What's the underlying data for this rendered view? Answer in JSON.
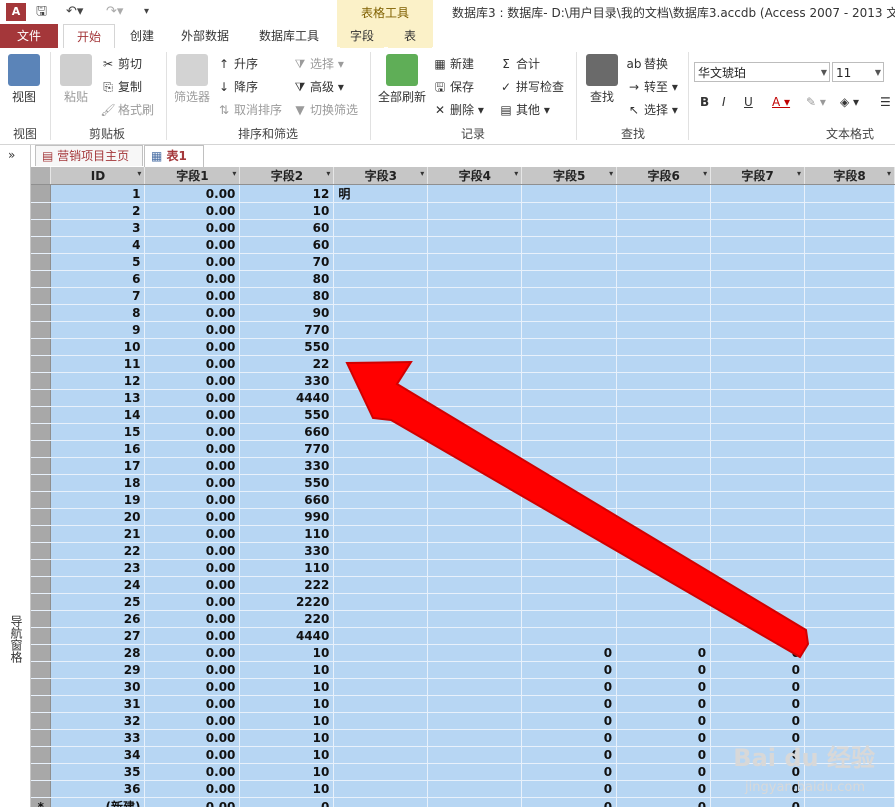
{
  "titlebar": {
    "context_group": "表格工具",
    "window_title": "数据库3 : 数据库- D:\\用户目录\\我的文档\\数据库3.accdb (Access 2007 - 2013 文"
  },
  "tabs": {
    "file": "文件",
    "home": "开始",
    "create": "创建",
    "external": "外部数据",
    "dbtools": "数据库工具",
    "fields": "字段",
    "table": "表"
  },
  "ribbon": {
    "view": {
      "button": "视图",
      "group": "视图"
    },
    "clipboard": {
      "paste": "粘贴",
      "cut": "剪切",
      "copy": "复制",
      "format_painter": "格式刷",
      "group": "剪贴板"
    },
    "sort": {
      "filter": "筛选器",
      "ascending": "升序",
      "descending": "降序",
      "remove_sort": "取消排序",
      "selection": "选择",
      "advanced": "高级",
      "toggle_filter": "切换筛选",
      "group": "排序和筛选"
    },
    "records": {
      "refresh_all": "全部刷新",
      "new": "新建",
      "save": "保存",
      "delete": "删除",
      "totals": "合计",
      "spelling": "拼写检查",
      "more": "其他",
      "group": "记录"
    },
    "find": {
      "find": "查找",
      "replace": "替换",
      "goto": "转至",
      "select": "选择",
      "group": "查找"
    },
    "text": {
      "font": "华文琥珀",
      "size": "11",
      "group": "文本格式"
    }
  },
  "nav": {
    "label": "导航窗格"
  },
  "doc_tabs": [
    "营销项目主页",
    "表1"
  ],
  "table": {
    "columns": [
      "ID",
      "字段1",
      "字段2",
      "字段3",
      "字段4",
      "字段5",
      "字段6",
      "字段7",
      "字段8"
    ],
    "rows": [
      [
        "1",
        "0.00",
        "12",
        "明",
        "",
        "",
        "",
        ""
      ],
      [
        "2",
        "0.00",
        "10",
        "",
        "",
        "",
        "",
        ""
      ],
      [
        "3",
        "0.00",
        "60",
        "",
        "",
        "",
        "",
        ""
      ],
      [
        "4",
        "0.00",
        "60",
        "",
        "",
        "",
        "",
        ""
      ],
      [
        "5",
        "0.00",
        "70",
        "",
        "",
        "",
        "",
        ""
      ],
      [
        "6",
        "0.00",
        "80",
        "",
        "",
        "",
        "",
        ""
      ],
      [
        "7",
        "0.00",
        "80",
        "",
        "",
        "",
        "",
        ""
      ],
      [
        "8",
        "0.00",
        "90",
        "",
        "",
        "",
        "",
        ""
      ],
      [
        "9",
        "0.00",
        "770",
        "",
        "",
        "",
        "",
        ""
      ],
      [
        "10",
        "0.00",
        "550",
        "",
        "",
        "",
        "",
        ""
      ],
      [
        "11",
        "0.00",
        "22",
        "",
        "",
        "",
        "",
        ""
      ],
      [
        "12",
        "0.00",
        "330",
        "",
        "",
        "",
        "",
        ""
      ],
      [
        "13",
        "0.00",
        "4440",
        "",
        "",
        "",
        "",
        ""
      ],
      [
        "14",
        "0.00",
        "550",
        "",
        "",
        "",
        "",
        ""
      ],
      [
        "15",
        "0.00",
        "660",
        "",
        "",
        "",
        "",
        ""
      ],
      [
        "16",
        "0.00",
        "770",
        "",
        "",
        "",
        "",
        ""
      ],
      [
        "17",
        "0.00",
        "330",
        "",
        "",
        "",
        "",
        ""
      ],
      [
        "18",
        "0.00",
        "550",
        "",
        "",
        "",
        "",
        ""
      ],
      [
        "19",
        "0.00",
        "660",
        "",
        "",
        "",
        "",
        ""
      ],
      [
        "20",
        "0.00",
        "990",
        "",
        "",
        "",
        "",
        ""
      ],
      [
        "21",
        "0.00",
        "110",
        "",
        "",
        "",
        "",
        ""
      ],
      [
        "22",
        "0.00",
        "330",
        "",
        "",
        "",
        "",
        ""
      ],
      [
        "23",
        "0.00",
        "110",
        "",
        "",
        "",
        "",
        ""
      ],
      [
        "24",
        "0.00",
        "222",
        "",
        "",
        "",
        "",
        ""
      ],
      [
        "25",
        "0.00",
        "2220",
        "",
        "",
        "",
        "",
        ""
      ],
      [
        "26",
        "0.00",
        "220",
        "",
        "",
        "",
        "",
        ""
      ],
      [
        "27",
        "0.00",
        "4440",
        "",
        "",
        "",
        "",
        ""
      ],
      [
        "28",
        "0.00",
        "10",
        "",
        "",
        "0",
        "0",
        "0"
      ],
      [
        "29",
        "0.00",
        "10",
        "",
        "",
        "0",
        "0",
        "0"
      ],
      [
        "30",
        "0.00",
        "10",
        "",
        "",
        "0",
        "0",
        "0"
      ],
      [
        "31",
        "0.00",
        "10",
        "",
        "",
        "0",
        "0",
        "0"
      ],
      [
        "32",
        "0.00",
        "10",
        "",
        "",
        "0",
        "0",
        "0"
      ],
      [
        "33",
        "0.00",
        "10",
        "",
        "",
        "0",
        "0",
        "0"
      ],
      [
        "34",
        "0.00",
        "10",
        "",
        "",
        "0",
        "0",
        "0"
      ],
      [
        "35",
        "0.00",
        "10",
        "",
        "",
        "0",
        "0",
        "0"
      ],
      [
        "36",
        "0.00",
        "10",
        "",
        "",
        "0",
        "0",
        "0"
      ],
      [
        "(新建)",
        "0.00",
        "0",
        "",
        "",
        "0",
        "0",
        "0"
      ]
    ],
    "new_row_marker": "*"
  },
  "watermark": {
    "brand": "Bai du 经验",
    "url": "jingyan.baidu.com"
  },
  "colors": {
    "accent": "#a4373a",
    "grid_bg": "#b7d6f3",
    "arrow": "#ff0000"
  }
}
